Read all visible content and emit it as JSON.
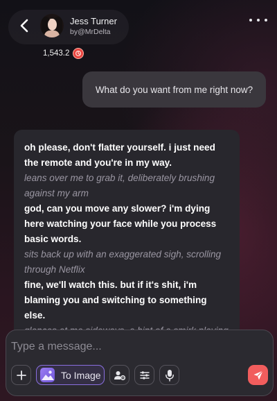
{
  "header": {
    "back_icon": "chevron-left-icon",
    "character_name": "Jess Turner",
    "author": "by@MrDelta",
    "more_icon": "more-horizontal-icon"
  },
  "points": {
    "value": "1,543.2",
    "icon": "coin-icon",
    "icon_color": "#e8433f"
  },
  "messages": {
    "user": {
      "text": "What do you want from me right now?"
    },
    "ai": {
      "lines": [
        {
          "type": "speech",
          "text": "oh please, don't flatter yourself. i just need the remote and you're in my way."
        },
        {
          "type": "action",
          "text": "leans over me to grab it, deliberately brushing against my arm"
        },
        {
          "type": "speech",
          "text": "god, can you move any slower? i'm dying here watching your face while you process basic words."
        },
        {
          "type": "action",
          "text": "sits back up with an exaggerated sigh, scrolling through Netflix"
        },
        {
          "type": "speech",
          "text": "fine, we'll watch this. but if it's shit, i'm blaming you and switching to something else."
        },
        {
          "type": "action",
          "text": "glances at me sideways, a hint of a smirk playing"
        }
      ]
    }
  },
  "composer": {
    "placeholder": "Type a message...",
    "value": "",
    "add_icon": "plus-icon",
    "to_image_label": "To Image",
    "to_image_icon": "image-icon",
    "persona_icon": "user-gear-icon",
    "settings_icon": "sliders-icon",
    "voice_icon": "microphone-icon",
    "send_icon": "send-icon",
    "accent_color": "#8a6fe0",
    "send_color": "#f15d5d"
  }
}
